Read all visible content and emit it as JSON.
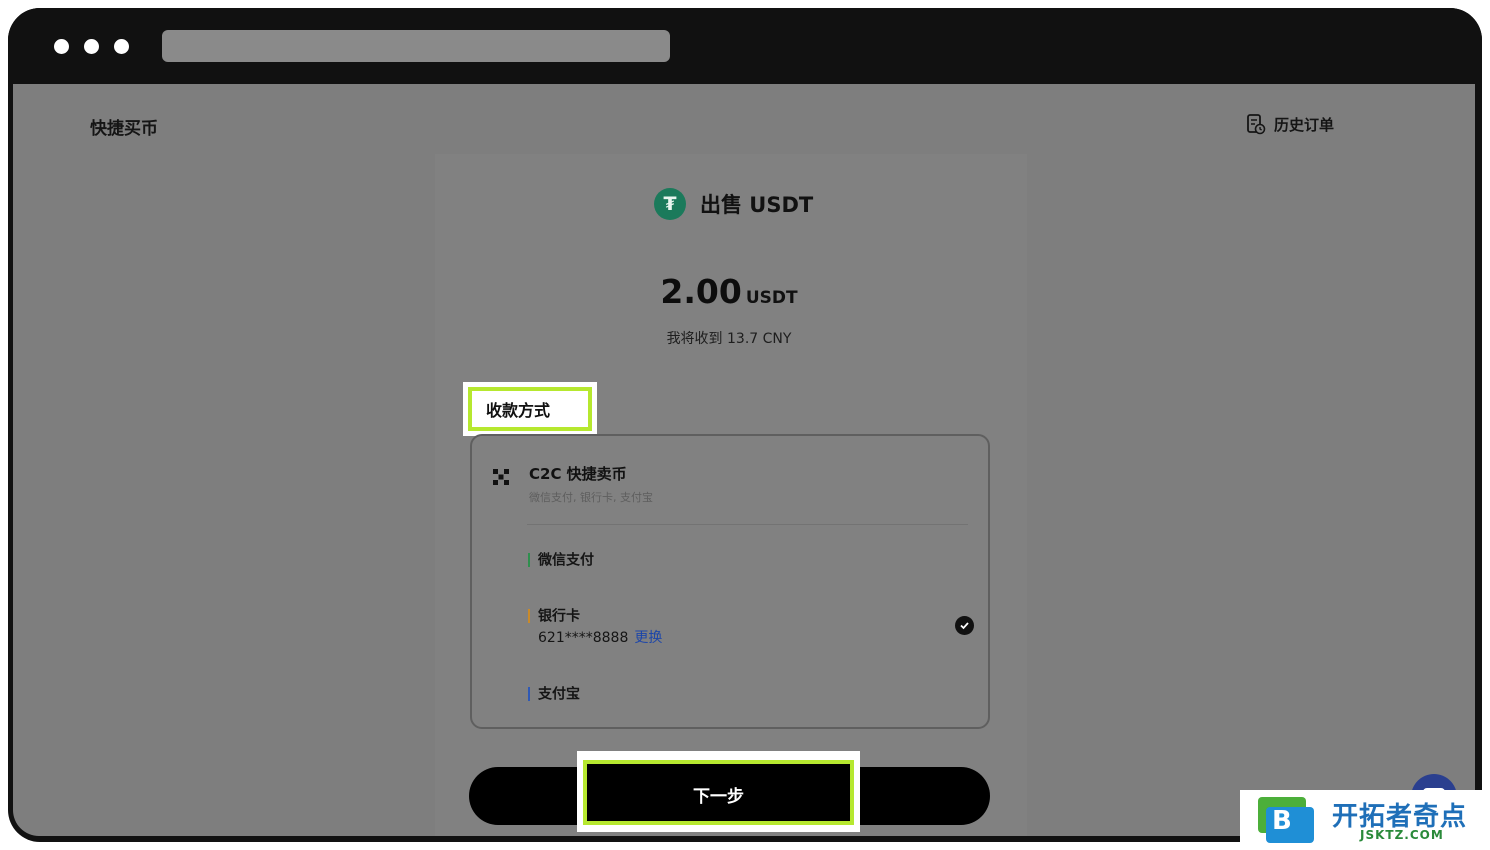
{
  "app": {
    "page_title": "快捷买币",
    "history_label": "历史订单"
  },
  "header": {
    "coin_symbol": "₮",
    "title": "出售 USDT"
  },
  "amount": {
    "value": "2.00",
    "unit": "USDT",
    "receive_text": "我将收到 13.7 CNY"
  },
  "payment": {
    "section_label": "收款方式",
    "c2c": {
      "title": "C2C 快捷卖币",
      "subtitle": "微信支付, 银行卡, 支付宝"
    },
    "options": [
      {
        "label": "微信支付",
        "bar_color": "#2f8f4e"
      },
      {
        "label": "银行卡",
        "detail": "621****8888",
        "action": "更换",
        "bar_color": "#c98a2a",
        "selected": true
      },
      {
        "label": "支付宝",
        "bar_color": "#2f59b5"
      }
    ]
  },
  "next_button": {
    "label": "下一步"
  },
  "watermark": {
    "text": "开拓者奇点",
    "url": "JSKTZ.COM"
  },
  "colors": {
    "highlight": "#b6e82f",
    "link": "#1d46a9",
    "coin": "#1b7a5b"
  }
}
